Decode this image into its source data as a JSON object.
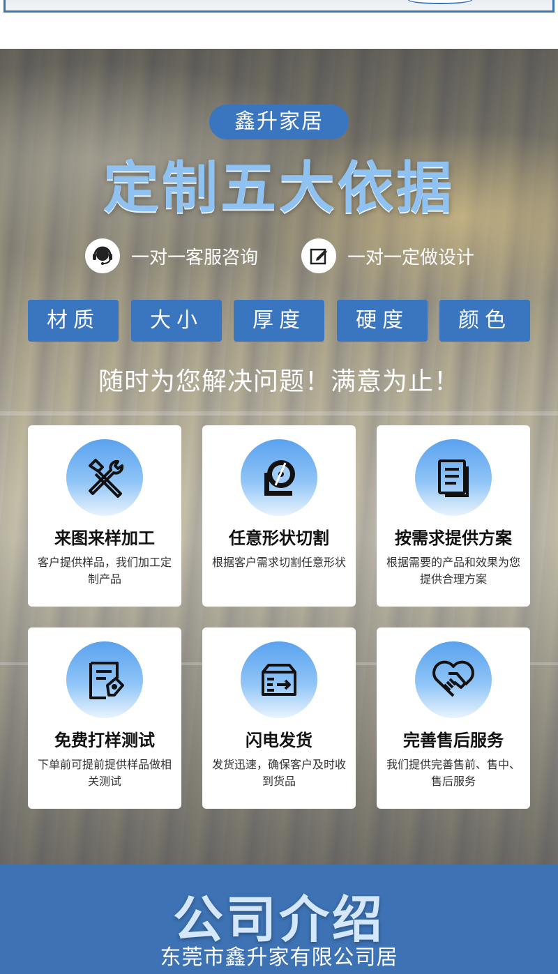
{
  "brand": {
    "label": "鑫升家居"
  },
  "hero": {
    "title": "定制五大依据",
    "features": [
      {
        "icon": "headset-icon",
        "label": "一对一客服咨询"
      },
      {
        "icon": "edit-icon",
        "label": "一对一定做设计"
      }
    ],
    "tags": [
      "材质",
      "大小",
      "厚度",
      "硬度",
      "颜色"
    ],
    "slogan": "随时为您解决问题！满意为止！"
  },
  "services": [
    {
      "icon": "tools-icon",
      "title": "来图来样加工",
      "desc": "客户提供样品，我们加工定制产品"
    },
    {
      "icon": "cutter-icon",
      "title": "任意形状切割",
      "desc": "根据客户需求切割任意形状"
    },
    {
      "icon": "document-icon",
      "title": "按需求提供方案",
      "desc": "根据需要的产品和效果为您提供合理方案"
    },
    {
      "icon": "test-report-icon",
      "title": "免费打样测试",
      "desc": "下单前可提前提供样品做相关测试"
    },
    {
      "icon": "delivery-box-icon",
      "title": "闪电发货",
      "desc": "发货迅速，确保客户及时收到货品"
    },
    {
      "icon": "handshake-heart-icon",
      "title": "完善售后服务",
      "desc": "我们提供完善售前、售中、售后服务"
    }
  ],
  "company": {
    "title": "公司介绍",
    "name": "东莞市鑫升家有限公司居"
  },
  "colors": {
    "accent": "#3a75c0",
    "title_blue": "#8fc2f0",
    "band": "#3d72b4"
  }
}
